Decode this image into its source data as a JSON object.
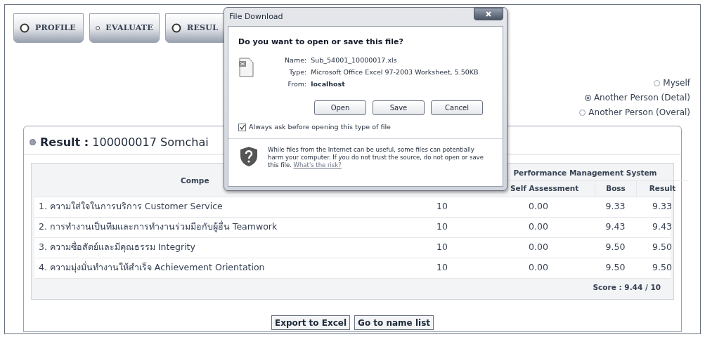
{
  "tabs": [
    {
      "label": "PROFILE"
    },
    {
      "label": "EVALUATE"
    },
    {
      "label": "RESUL"
    }
  ],
  "view_options": [
    {
      "label": "Myself",
      "selected": false
    },
    {
      "label": "Another Person (Detal)",
      "selected": true
    },
    {
      "label": "Another Person (Overal)",
      "selected": false
    }
  ],
  "result_panel": {
    "title_label": "Result :",
    "title_value": "100000017 Somchai",
    "table": {
      "group_header": "Performance Management System",
      "columns": {
        "competency": "Compe",
        "self_assessment": "Self Assessment",
        "boss": "Boss",
        "result": "Result"
      },
      "rows": [
        {
          "competency": "1. ความใส่ใจในการบริการ Customer Service",
          "column_2": "10",
          "self_assessment": "0.00",
          "boss": "9.33",
          "result": "9.33"
        },
        {
          "competency": "2. การทำงานเป็นทีมและการทำงานร่วมมือกับผู้อื่น Teamwork",
          "column_2": "10",
          "self_assessment": "0.00",
          "boss": "9.43",
          "result": "9.43"
        },
        {
          "competency": "3. ความซื่อสัตย์และมีคุณธรรม Integrity",
          "column_2": "10",
          "self_assessment": "0.00",
          "boss": "9.50",
          "result": "9.50"
        },
        {
          "competency": "4. ความมุ่งมั่นทำงานให้สำเร็จ Achievement Orientation",
          "column_2": "10",
          "self_assessment": "0.00",
          "boss": "9.50",
          "result": "9.50"
        }
      ],
      "score": "Score : 9.44  / 10"
    },
    "buttons": [
      "Export to Excel",
      "Go to name list"
    ]
  },
  "dialog": {
    "title": "File Download",
    "heading": "Do you want to open or save this file?",
    "fields": [
      {
        "label": "Name:",
        "value": "Sub_54001_10000017.xls",
        "bold": false
      },
      {
        "label": "Type:",
        "value": "Microsoft Office Excel 97-2003 Worksheet, 5.50KB",
        "bold": false
      },
      {
        "label": "From:",
        "value": "localhost",
        "bold": true
      }
    ],
    "buttons": [
      "Open",
      "Save",
      "Cancel"
    ],
    "always_ask": {
      "label": "Always ask before opening this type of file",
      "checked": true
    },
    "warning": "While files from the Internet can be useful, some files can potentially harm your computer. If you do not trust the source, do not open or save this file.",
    "risk_link": "What's the risk?"
  }
}
